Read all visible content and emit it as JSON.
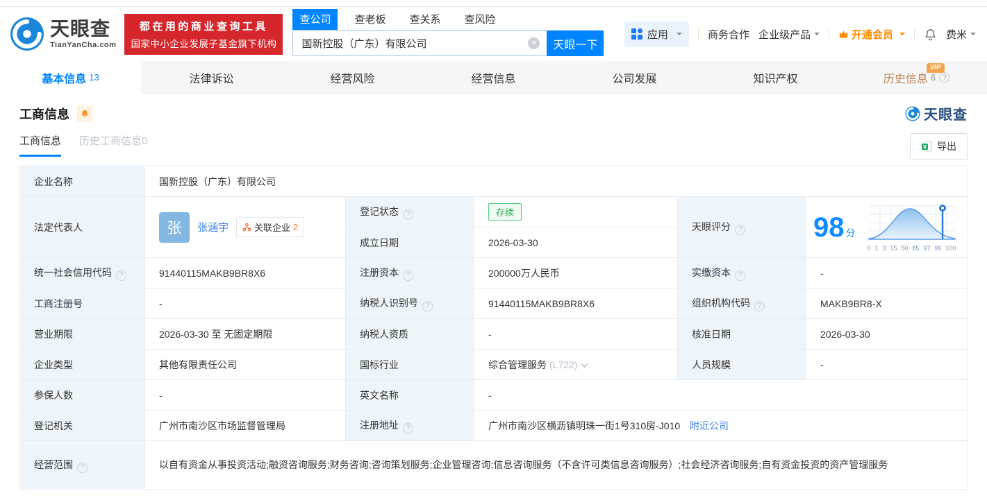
{
  "header": {
    "logo": {
      "name": "天眼查",
      "domain": "TianYanCha.com"
    },
    "slogan": [
      "都在用的商业查询工具",
      "国家中小企业发展子基金旗下机构"
    ],
    "search_tabs": [
      {
        "label": "查公司"
      },
      {
        "label": "查老板"
      },
      {
        "label": "查关系"
      },
      {
        "label": "查风险"
      }
    ],
    "search_value": "国新控股（广东）有限公司",
    "search_button": "天眼一下",
    "nav": {
      "apps": "应用",
      "coop": "商务合作",
      "enterprise": "企业级产品",
      "vip": "开通会员",
      "user": "费米"
    }
  },
  "page_tabs": [
    {
      "label": "基本信息",
      "count": "13"
    },
    {
      "label": "法律诉讼"
    },
    {
      "label": "经营风险"
    },
    {
      "label": "经营信息"
    },
    {
      "label": "公司发展"
    },
    {
      "label": "知识产权"
    },
    {
      "label": "历史信息",
      "count": "6",
      "badge": "VIP"
    }
  ],
  "section": {
    "title": "工商信息",
    "brand": "天眼查"
  },
  "subtabs": [
    {
      "label": "工商信息"
    },
    {
      "label": "历史工商信息0"
    }
  ],
  "toolbar": {
    "export_label": "导出"
  },
  "fields": {
    "company_name": {
      "label": "企业名称",
      "value": "国新控股（广东）有限公司"
    },
    "legal_rep": {
      "label": "法定代表人",
      "avatar": "张",
      "name": "张涵宇",
      "related_label": "关联企业",
      "related_count": "2"
    },
    "reg_status": {
      "label": "登记状态",
      "value": "存续"
    },
    "establish_date": {
      "label": "成立日期",
      "value": "2026-03-30"
    },
    "score": {
      "label": "天眼评分",
      "value": "98",
      "unit": "分",
      "axis": [
        "0",
        "1",
        "3",
        "15",
        "50",
        "85",
        "97",
        "99",
        "100"
      ]
    },
    "credit_code": {
      "label": "统一社会信用代码",
      "value": "91440115MAKB9BR8X6"
    },
    "reg_capital": {
      "label": "注册资本",
      "value": "200000万人民币"
    },
    "paid_capital": {
      "label": "实缴资本",
      "value": "-"
    },
    "reg_no": {
      "label": "工商注册号",
      "value": "-"
    },
    "taxpayer_no": {
      "label": "纳税人识别号",
      "value": "91440115MAKB9BR8X6"
    },
    "org_code": {
      "label": "组织机构代码",
      "value": "MAKB9BR8-X"
    },
    "term": {
      "label": "营业期限",
      "value": "2026-03-30 至 无固定期限"
    },
    "taxpayer_quality": {
      "label": "纳税人资质",
      "value": "-"
    },
    "approve_date": {
      "label": "核准日期",
      "value": "2026-03-30"
    },
    "company_type": {
      "label": "企业类型",
      "value": "其他有限责任公司"
    },
    "industry": {
      "label": "国标行业",
      "value": "综合管理服务",
      "code": "(L722)"
    },
    "staff_size": {
      "label": "人员规模",
      "value": "-"
    },
    "insured_num": {
      "label": "参保人数",
      "value": "-"
    },
    "english_name": {
      "label": "英文名称",
      "value": "-"
    },
    "registry": {
      "label": "登记机关",
      "value": "广州市南沙区市场监督管理局"
    },
    "address": {
      "label": "注册地址",
      "value": "广州市南沙区横沥镇明珠一街1号310房-J010",
      "nearby": "附近公司"
    },
    "scope": {
      "label": "经营范围",
      "value": "以自有资金从事投资活动;融资咨询服务;财务咨询;咨询策划服务;企业管理咨询;信息咨询服务（不含许可类信息咨询服务）;社会经济咨询服务;自有资金投资的资产管理服务"
    }
  }
}
